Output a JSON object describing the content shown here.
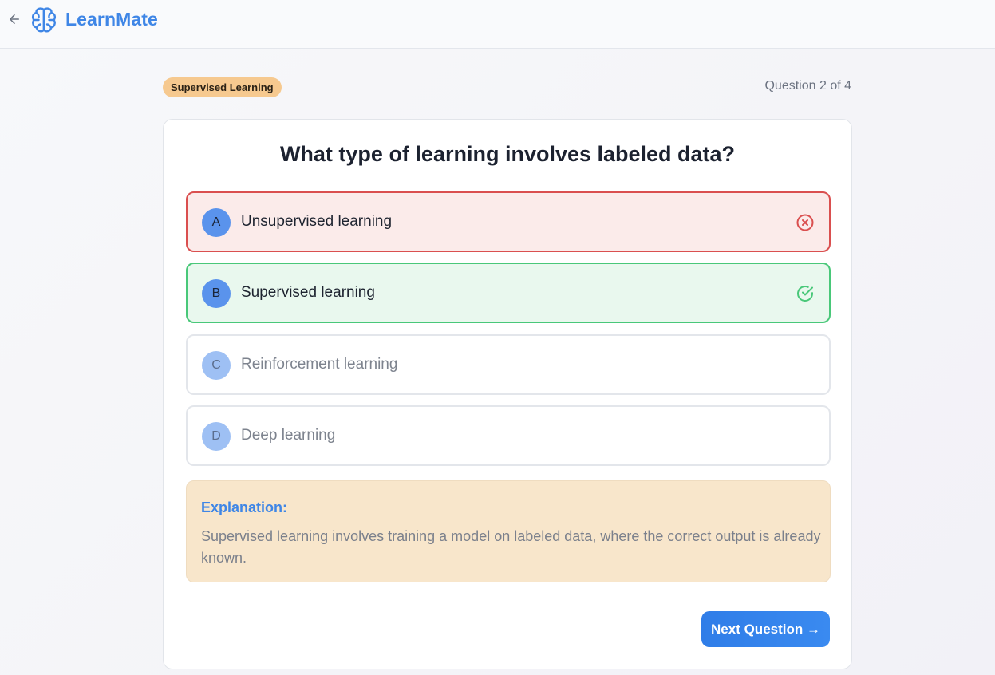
{
  "app": {
    "name": "LearnMate",
    "logo_icon": "brain-icon",
    "back_icon": "arrow-left-icon"
  },
  "quiz": {
    "topic": "Supervised Learning",
    "progress": "Question 2 of 4",
    "question": "What type of learning involves labeled data?",
    "options": [
      {
        "letter": "A",
        "text": "Unsupervised learning",
        "state": "incorrect",
        "icon": "x-circle-icon"
      },
      {
        "letter": "B",
        "text": "Supervised learning",
        "state": "correct",
        "icon": "check-circle-icon"
      },
      {
        "letter": "C",
        "text": "Reinforcement learning",
        "state": "unselected"
      },
      {
        "letter": "D",
        "text": "Deep learning",
        "state": "unselected"
      }
    ],
    "explanation": {
      "title": "Explanation:",
      "body": "Supervised learning involves training a model on labeled data, where the correct output is already known."
    },
    "next_button": "Next Question →"
  },
  "colors": {
    "brand": "#3f86e6",
    "incorrect": "#da4f4f",
    "correct": "#49c879",
    "badge": "#f6c98f",
    "explanation_bg": "#f8e6cb"
  }
}
